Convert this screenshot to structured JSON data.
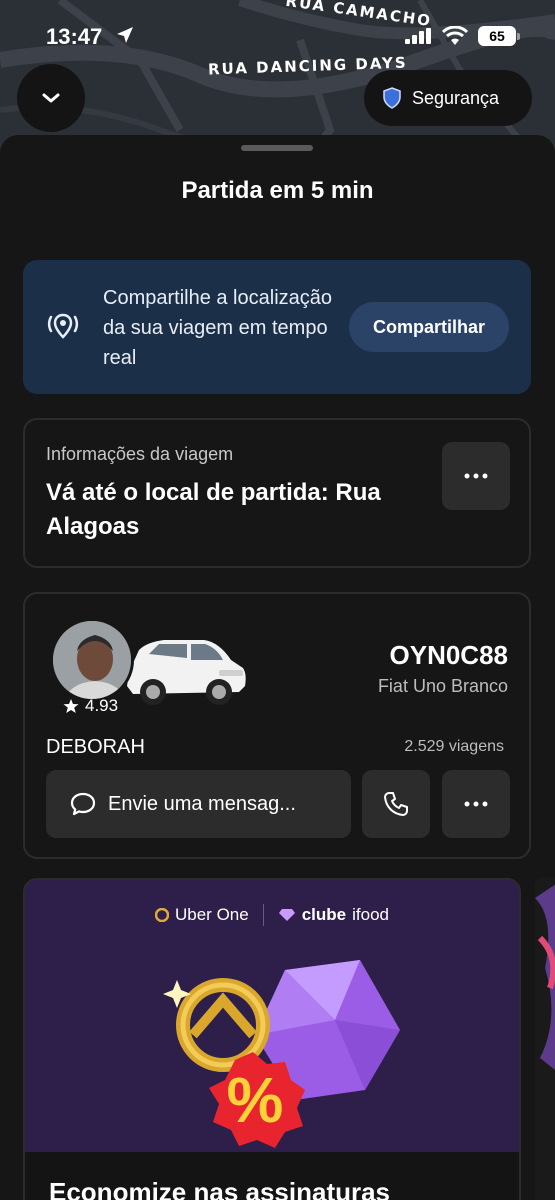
{
  "status_bar": {
    "time": "13:47",
    "battery": "65"
  },
  "map": {
    "street_1": "RUA CAMACHO",
    "street_2": "RUA DANCING DAYS"
  },
  "safety_button": {
    "label": "Segurança",
    "icon": "shield-icon"
  },
  "collapse_button": {
    "icon": "chevron-down-icon"
  },
  "sheet": {
    "title": "Partida em 5 min"
  },
  "share": {
    "text": "Compartilhe a localização da sua viagem em tempo real",
    "button": "Compartilhar",
    "icon": "location-broadcast-icon"
  },
  "trip_info": {
    "label": "Informações da viagem",
    "destination": "Vá até o local de partida: Rua Alagoas"
  },
  "driver": {
    "rating": "4.93",
    "plate": "OYN0C88",
    "car_model": "Fiat Uno Branco",
    "name": "DEBORAH",
    "trips": "2.529 viagens",
    "message_button": "Envie uma mensag..."
  },
  "promo": {
    "brand_1": "Uber One",
    "brand_2_prefix": "clube",
    "brand_2_suffix": "ifood",
    "discount_symbol": "%",
    "title": "Economize nas assinaturas"
  },
  "colors": {
    "sheet_bg": "#161616",
    "share_card_bg": "#1c2f49",
    "promo_bg": "#2e1f4a",
    "safety_shield": "#3b6fd9"
  }
}
